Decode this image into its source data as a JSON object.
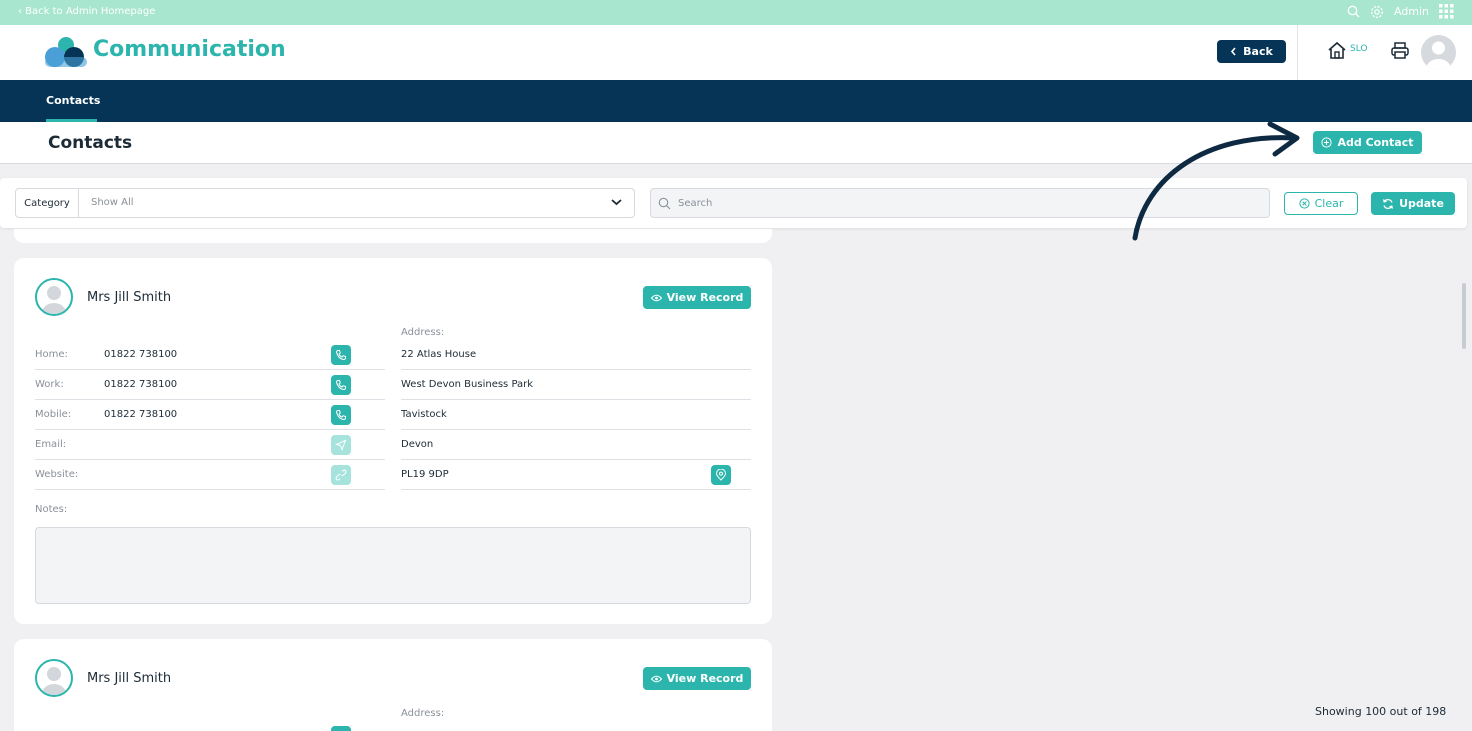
{
  "top_strip": {
    "back_link": "‹ Back to Admin Homepage",
    "admin_label": "Admin"
  },
  "header": {
    "app_title": "Communication",
    "back_label": "Back",
    "slo_label": "SLO"
  },
  "nav": {
    "tab_label": "Contacts"
  },
  "page": {
    "title": "Contacts",
    "add_label": "Add Contact"
  },
  "filters": {
    "category_label": "Category",
    "category_value": "Show All",
    "search_placeholder": "Search",
    "clear_label": "Clear",
    "update_label": "Update"
  },
  "contacts": [
    {
      "name": "Mrs Jill Smith",
      "view_label": "View Record",
      "address_label": "Address:",
      "phones": [
        {
          "label": "Home:",
          "value": "01822 738100"
        },
        {
          "label": "Work:",
          "value": "01822 738100"
        },
        {
          "label": "Mobile:",
          "value": "01822 738100"
        },
        {
          "label": "Email:",
          "value": ""
        },
        {
          "label": "Website:",
          "value": ""
        }
      ],
      "address": [
        "22 Atlas House",
        "West Devon Business Park",
        "Tavistock",
        "Devon",
        "PL19 9DP"
      ],
      "notes_label": "Notes:"
    },
    {
      "name": "Mrs Jill Smith",
      "view_label": "View Record",
      "address_label": "Address:"
    }
  ],
  "footer": {
    "showing": "Showing 100 out of 198"
  },
  "colors": {
    "accent": "#2bb5ac",
    "navy": "#053456",
    "strip": "#a8e6cf"
  }
}
